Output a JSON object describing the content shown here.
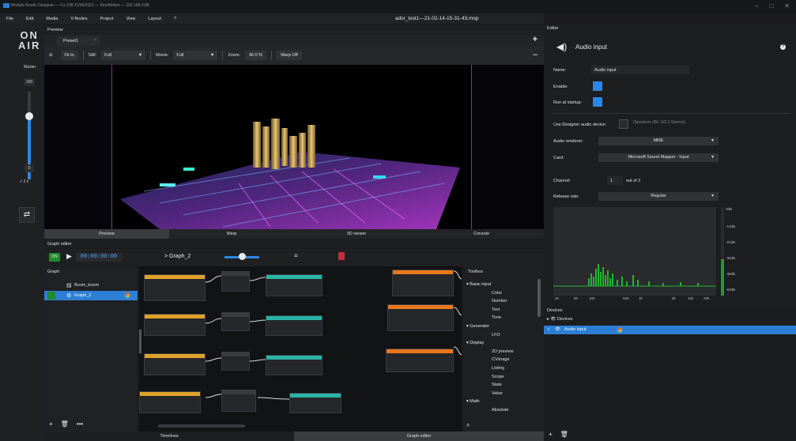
{
  "app": {
    "title": "Modulo Kinetic Designer — 4.x 108 21/06/2021 — KineMotion — 192.168.0.88",
    "file_name": "adsr_test1—21-02-14-15-31-43.mop",
    "window_buttons": [
      "–",
      "□",
      "✕"
    ]
  },
  "menu": [
    "File",
    "Edit",
    "Media",
    "V-Nodes",
    "Project",
    "View",
    "Layout",
    "?"
  ],
  "leftbar": {
    "on_air_top": "ON",
    "on_air_bottom": "AIR",
    "master_label": "Master",
    "master_value": "100",
    "master_level": 0.72,
    "zero_value": "0",
    "transition_time": "↗  2 s",
    "cast_icon": "⇄"
  },
  "preview": {
    "header": "Preview",
    "tab": "Preset1",
    "tab_close": "×",
    "toolbar": {
      "fit_to": "Fit to",
      "still_label": "Still:",
      "still_value": "Full",
      "movie_label": "Movie:",
      "movie_value": "Full",
      "zoom_label": "Zoom:",
      "zoom_value": "46.0 %",
      "warp": "Warp Off",
      "more": "•••"
    },
    "tabs": [
      "Preview",
      "Warp",
      "3D viewer",
      "Console"
    ]
  },
  "graph_editor": {
    "header": "Graph editor",
    "on_label": "ON",
    "timecode": "00:00:00:00",
    "current_graph": "> Graph_2",
    "graphs_label": "Graph",
    "graphs": [
      "Boom_boom",
      "Graph_2"
    ],
    "toolbox_label": "Toolbox",
    "toolbox": [
      {
        "kind": "cat",
        "label": "Basic input"
      },
      {
        "kind": "item",
        "label": "Color"
      },
      {
        "kind": "item",
        "label": "Number"
      },
      {
        "kind": "item",
        "label": "Text"
      },
      {
        "kind": "item",
        "label": "Time"
      },
      {
        "kind": "cat",
        "label": "Generator"
      },
      {
        "kind": "item",
        "label": "LFO"
      },
      {
        "kind": "cat",
        "label": "Display"
      },
      {
        "kind": "item",
        "label": "2D preview"
      },
      {
        "kind": "item",
        "label": "CVimage"
      },
      {
        "kind": "item",
        "label": "Listing"
      },
      {
        "kind": "item",
        "label": "Scope"
      },
      {
        "kind": "item",
        "label": "State"
      },
      {
        "kind": "item",
        "label": "Value"
      },
      {
        "kind": "cat",
        "label": "Math"
      },
      {
        "kind": "item",
        "label": "Absolute"
      }
    ]
  },
  "bottom_tabs": [
    "Timelines",
    "Graph editor"
  ],
  "editor": {
    "header": "Editor",
    "title": "Audio input",
    "name_label": "Name:",
    "name_value": "Audio input",
    "enable_label": "Enable:",
    "run_label": "Run at startup:",
    "use_designer_label": "Use Designer audio device:",
    "use_designer_hint": "(Speakers (Bit, GO 2 Stereo))",
    "renderer_label": "Audio renderer:",
    "renderer_value": "MME",
    "card_label": "Card:",
    "card_value": "Microsoft Sound Mapper - Input",
    "channel_label": "Channel:",
    "channel_value": "1",
    "channel_out_of": "out of 2",
    "release_label": "Release rate:",
    "release_value": "Regular",
    "db_labels": [
      "0dB",
      "-12dB",
      "-24dB",
      "-36dB",
      "-48dB",
      "-60dB"
    ],
    "freq_labels": [
      "20",
      "50",
      "100",
      "500",
      "1k",
      "5k",
      "10k",
      "20k"
    ],
    "vu_level": 0.41,
    "colors": {
      "accent": "#2d86e3",
      "spectrum": "#1fb52e",
      "on": "#1f8a2e"
    }
  },
  "devices": {
    "header": "Devices",
    "items": [
      "Devices",
      "Audio input"
    ]
  }
}
